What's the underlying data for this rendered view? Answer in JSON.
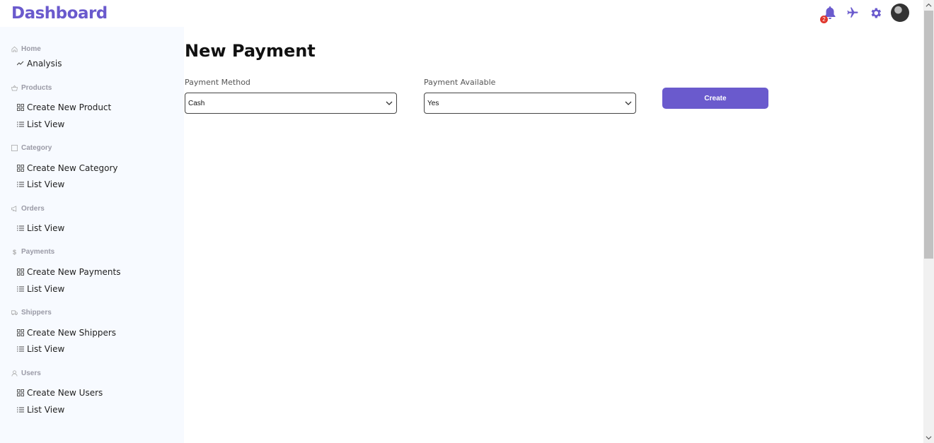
{
  "header": {
    "brand": "Dashboard",
    "notification_count": "2"
  },
  "sidebar": {
    "sections": [
      {
        "title": "Home",
        "icon": "home-icon",
        "items": [
          {
            "label": "Analysis",
            "icon": "trend-icon"
          }
        ]
      },
      {
        "title": "Products",
        "icon": "basket-icon",
        "items": [
          {
            "label": "Create New Product",
            "icon": "grid-icon"
          },
          {
            "label": "List View",
            "icon": "list-icon"
          }
        ]
      },
      {
        "title": "Category",
        "icon": "square-icon",
        "items": [
          {
            "label": "Create New Category",
            "icon": "grid-icon"
          },
          {
            "label": "List View",
            "icon": "list-icon"
          }
        ]
      },
      {
        "title": "Orders",
        "icon": "megaphone-icon",
        "items": [
          {
            "label": "List View",
            "icon": "list-icon"
          }
        ]
      },
      {
        "title": "Payments",
        "icon": "dollar-icon",
        "items": [
          {
            "label": "Create New Payments",
            "icon": "grid-icon"
          },
          {
            "label": "List View",
            "icon": "list-icon"
          }
        ]
      },
      {
        "title": "Shippers",
        "icon": "truck-icon",
        "items": [
          {
            "label": "Create New Shippers",
            "icon": "grid-icon"
          },
          {
            "label": "List View",
            "icon": "list-icon"
          }
        ]
      },
      {
        "title": "Users",
        "icon": "user-icon",
        "items": [
          {
            "label": "Create New Users",
            "icon": "grid-icon"
          },
          {
            "label": "List View",
            "icon": "list-icon"
          }
        ]
      }
    ]
  },
  "main": {
    "title": "New Payment",
    "payment_method": {
      "label": "Payment Method",
      "value": "Cash"
    },
    "payment_available": {
      "label": "Payment Available",
      "value": "Yes"
    },
    "create_label": "Create"
  },
  "colors": {
    "accent": "#6a5acd",
    "sidebar_bg": "#f7faff",
    "badge": "#e0352b"
  }
}
